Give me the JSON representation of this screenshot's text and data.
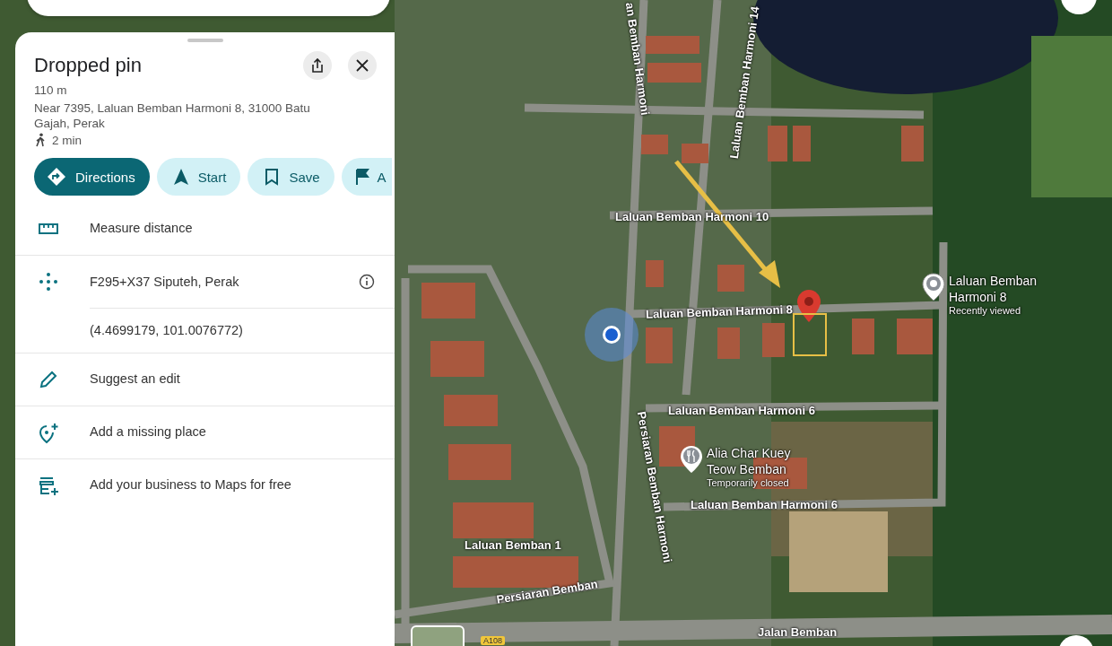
{
  "panel": {
    "title": "Dropped pin",
    "distance": "110 m",
    "address": "Near 7395, Laluan Bemban Harmoni 8, 31000 Batu Gajah, Perak",
    "walk_time": "2 min",
    "actions": [
      {
        "label": "Directions",
        "kind": "primary"
      },
      {
        "label": "Start",
        "kind": "secondary"
      },
      {
        "label": "Save",
        "kind": "secondary"
      },
      {
        "label": "A",
        "kind": "secondary"
      }
    ],
    "menu": [
      {
        "kind": "measure",
        "label": "Measure distance"
      },
      {
        "kind": "pluscode",
        "label": "F295+X37 Siputeh, Perak",
        "sublabel": "(4.4699179, 101.0076772)"
      },
      {
        "kind": "edit",
        "label": "Suggest an edit"
      },
      {
        "kind": "add-place",
        "label": "Add a missing place"
      },
      {
        "kind": "business",
        "label": "Add your business to Maps for free"
      }
    ]
  },
  "map": {
    "streets": [
      "an Bemban Harmoni",
      "Laluan Bemban Harmoni 14",
      "Laluan Bemban Harmoni 10",
      "Laluan Bemban Harmoni 8",
      "Laluan Bemban Harmoni 6",
      "Laluan Bemban Harmoni 6",
      "Persiaran Bemban Harmoni",
      "Laluan Bemban 1",
      "Persiaran Bemban",
      "Jalan Bemban"
    ],
    "route_shield": "A108",
    "places": [
      {
        "kind": "pin",
        "name": "Laluan Bemban Harmoni 8",
        "status": "Recently viewed"
      },
      {
        "kind": "restaurant",
        "name": "Alia Char Kuey Teow Bemban",
        "status": "Temporarily closed"
      }
    ]
  }
}
